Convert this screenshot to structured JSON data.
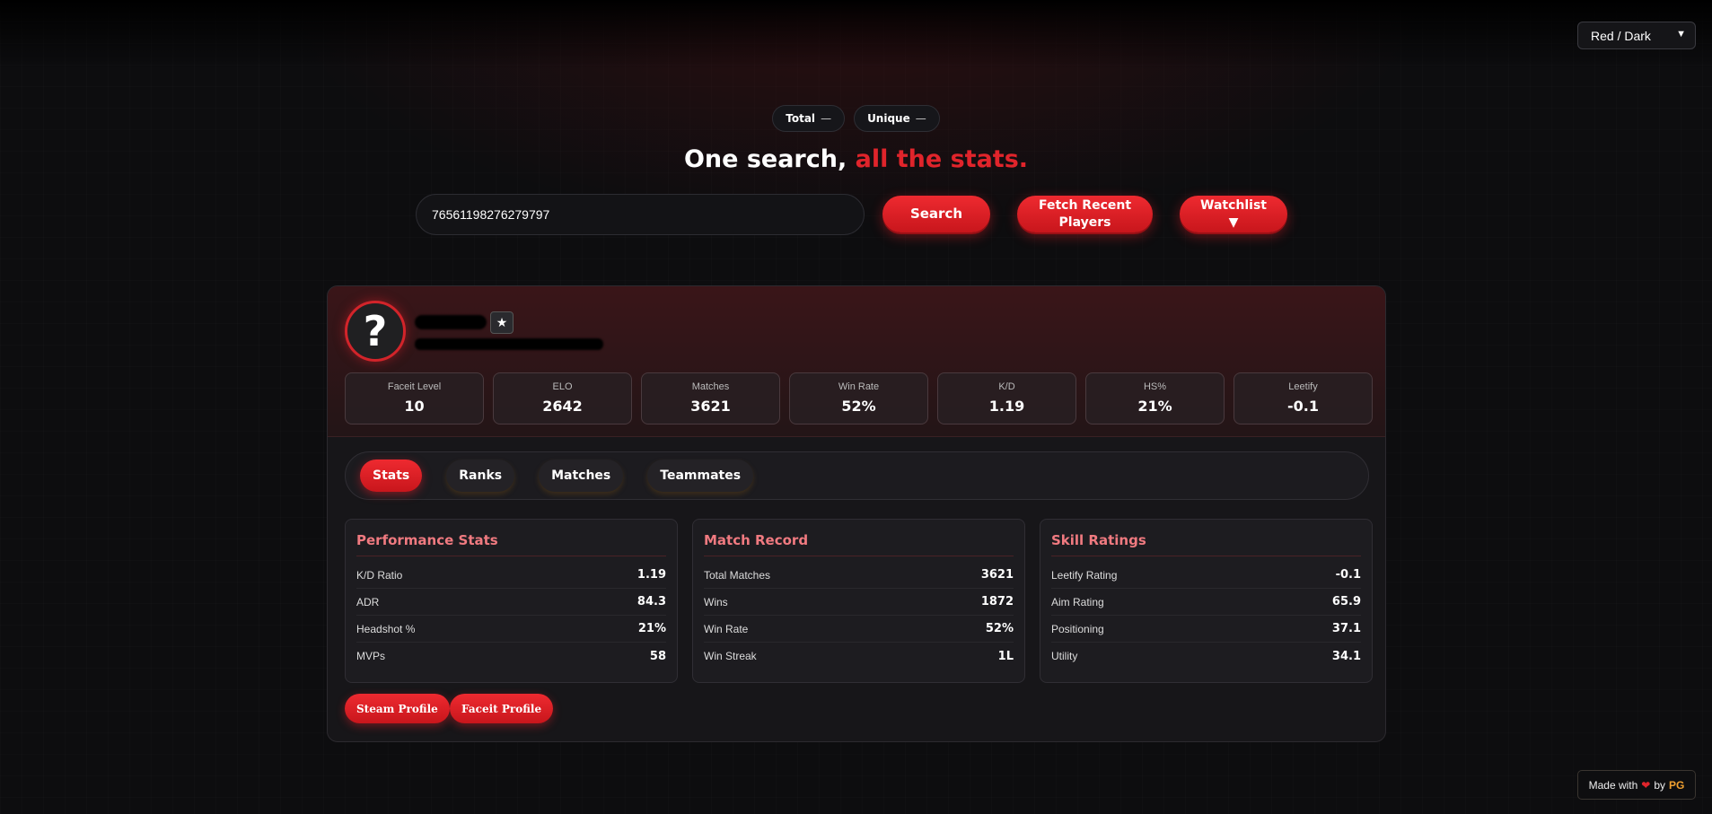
{
  "theme": {
    "selected": "Red / Dark"
  },
  "counters": [
    {
      "label": "Total",
      "value": "—"
    },
    {
      "label": "Unique",
      "value": "—"
    }
  ],
  "headline": {
    "main": "One search,",
    "accent": "all the stats."
  },
  "search": {
    "value": "76561198276279797",
    "button": "Search"
  },
  "actions": {
    "fetch_line1": "Fetch Recent",
    "fetch_line2": "Players",
    "watchlist": "Watchlist",
    "watchlist_arrow": "▼"
  },
  "profile": {
    "avatar_glyph": "?",
    "favorite_glyph": "★",
    "stats": [
      {
        "label": "Faceit Level",
        "value": "10"
      },
      {
        "label": "ELO",
        "value": "2642"
      },
      {
        "label": "Matches",
        "value": "3621"
      },
      {
        "label": "Win Rate",
        "value": "52%"
      },
      {
        "label": "K/D",
        "value": "1.19"
      },
      {
        "label": "HS%",
        "value": "21%"
      },
      {
        "label": "Leetify",
        "value": "-0.1"
      }
    ]
  },
  "tabs": [
    "Stats",
    "Ranks",
    "Matches",
    "Teammates"
  ],
  "panels": [
    {
      "title": "Performance Stats",
      "rows": [
        {
          "label": "K/D Ratio",
          "value": "1.19"
        },
        {
          "label": "ADR",
          "value": "84.3"
        },
        {
          "label": "Headshot %",
          "value": "21%"
        },
        {
          "label": "MVPs",
          "value": "58"
        }
      ]
    },
    {
      "title": "Match Record",
      "rows": [
        {
          "label": "Total Matches",
          "value": "3621"
        },
        {
          "label": "Wins",
          "value": "1872"
        },
        {
          "label": "Win Rate",
          "value": "52%"
        },
        {
          "label": "Win Streak",
          "value": "1L"
        }
      ]
    },
    {
      "title": "Skill Ratings",
      "rows": [
        {
          "label": "Leetify Rating",
          "value": "-0.1"
        },
        {
          "label": "Aim Rating",
          "value": "65.9"
        },
        {
          "label": "Positioning",
          "value": "37.1"
        },
        {
          "label": "Utility",
          "value": "34.1"
        }
      ]
    }
  ],
  "links": {
    "steam": "Steam Profile",
    "faceit": "Faceit Profile"
  },
  "footer": {
    "prefix": "Made with",
    "suffix": "by",
    "author": "PG"
  },
  "colors": {
    "accent": "#e0242b",
    "background": "#0d0d0f",
    "panel_title": "#f07a80"
  }
}
